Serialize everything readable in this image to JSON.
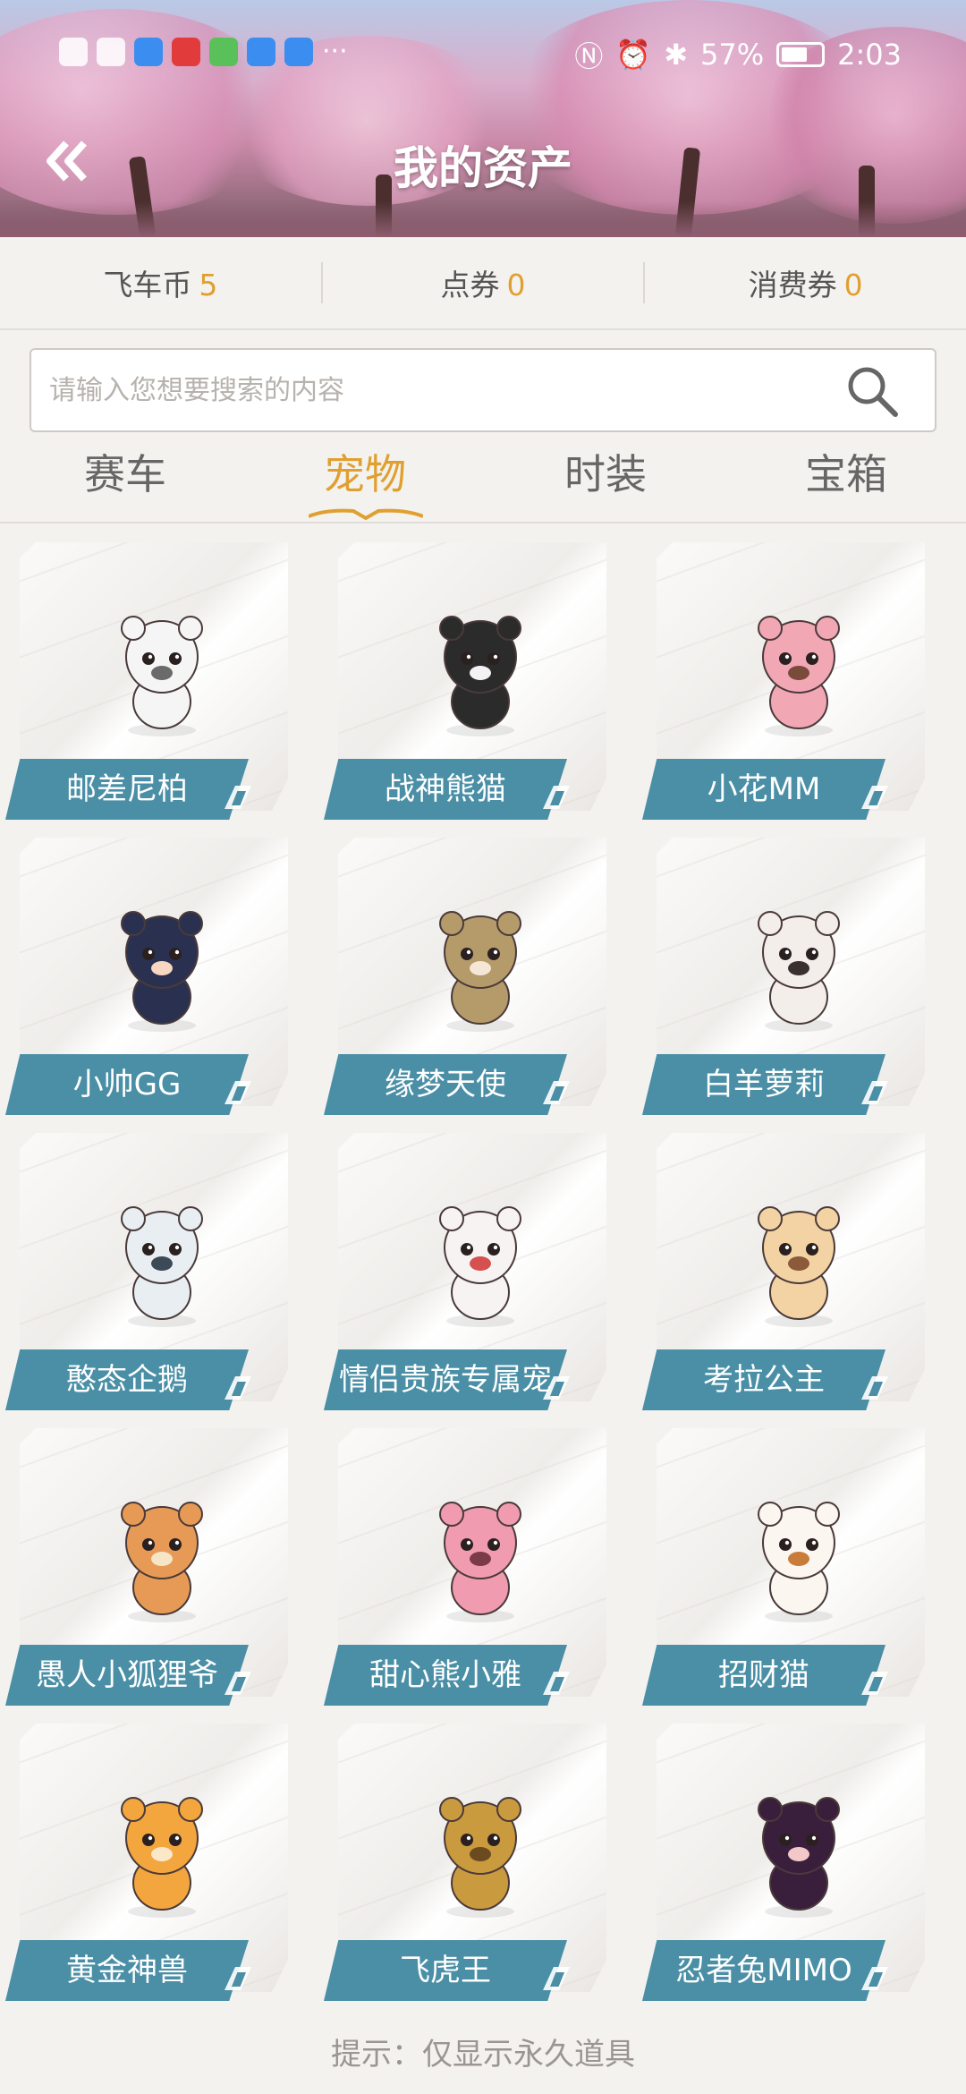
{
  "status_bar": {
    "battery_percent": "57%",
    "time": "2:03",
    "left_icons": [
      "hd-icon",
      "signal-icon",
      "app-cloud-icon",
      "app-book-icon",
      "wechat-icon",
      "browser-icon",
      "cloud-icon",
      "more-dots-icon"
    ],
    "right_icons": [
      "nfc-icon",
      "alarm-icon",
      "bluetooth-icon",
      "battery-icon"
    ]
  },
  "header": {
    "title": "我的资产"
  },
  "balances": [
    {
      "label": "飞车币",
      "value": "5"
    },
    {
      "label": "点券",
      "value": "0"
    },
    {
      "label": "消费券",
      "value": "0"
    }
  ],
  "search": {
    "placeholder": "请输入您想要搜索的内容"
  },
  "tabs": [
    {
      "label": "赛车",
      "active": false
    },
    {
      "label": "宠物",
      "active": true
    },
    {
      "label": "时装",
      "active": false
    },
    {
      "label": "宝箱",
      "active": false
    }
  ],
  "pets": [
    {
      "name": "邮差尼柏",
      "color": "#f5f5f5",
      "accent": "#6a6a6a"
    },
    {
      "name": "战神熊猫",
      "color": "#2b2b2b",
      "accent": "#f3f3f3"
    },
    {
      "name": "小花MM",
      "color": "#f2a7b5",
      "accent": "#7a4a3a"
    },
    {
      "name": "小帅GG",
      "color": "#2a3150",
      "accent": "#f7d6c2"
    },
    {
      "name": "缘梦天使",
      "color": "#b59a6a",
      "accent": "#f5e6d6"
    },
    {
      "name": "白羊萝莉",
      "color": "#f4eeea",
      "accent": "#3a3030"
    },
    {
      "name": "憨态企鹅",
      "color": "#e9eef3",
      "accent": "#3c4a58"
    },
    {
      "name": "情侣贵族专属宠",
      "color": "#f7f3f3",
      "accent": "#d65050"
    },
    {
      "name": "考拉公主",
      "color": "#f3d3a3",
      "accent": "#8a5a3a"
    },
    {
      "name": "愚人小狐狸爷",
      "color": "#e69a55",
      "accent": "#f5e6c8"
    },
    {
      "name": "甜心熊小雅",
      "color": "#f19bb0",
      "accent": "#7a3a4a"
    },
    {
      "name": "招财猫",
      "color": "#fbf6f0",
      "accent": "#c97b3a"
    },
    {
      "name": "黄金神兽",
      "color": "#f3a53e",
      "accent": "#fbe8c8"
    },
    {
      "name": "飞虎王",
      "color": "#c99a3e",
      "accent": "#6b4a20"
    },
    {
      "name": "忍者兔MIMO",
      "color": "#3a1f3c",
      "accent": "#f2c8c8"
    }
  ],
  "hint": "提示：仅显示永久道具"
}
